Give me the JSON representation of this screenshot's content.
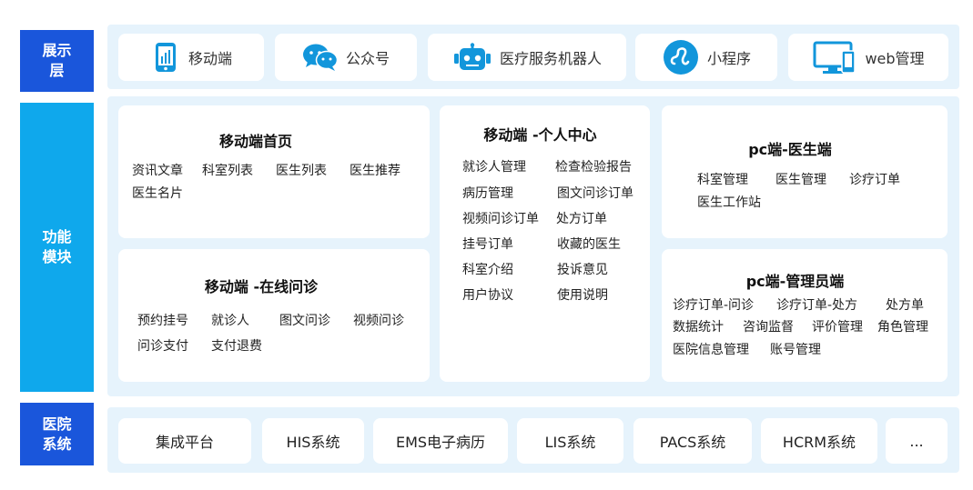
{
  "colors": {
    "presentation_label": "#1a56db",
    "function_label": "#0fa8ec",
    "hospital_label": "#1a56db",
    "band": "#e6f3fc",
    "icon": "#1296db"
  },
  "layers": {
    "presentation": {
      "label": "展示层",
      "items": [
        {
          "label": "移动端",
          "icon": "mobile-phone-icon"
        },
        {
          "label": "公众号",
          "icon": "wechat-icon"
        },
        {
          "label": "医疗服务机器人",
          "icon": "robot-icon"
        },
        {
          "label": "小程序",
          "icon": "mini-program-icon"
        },
        {
          "label": "web管理",
          "icon": "desktop-monitor-icon"
        }
      ]
    },
    "function": {
      "label": "功能模块",
      "modules": {
        "mobile_home": {
          "title": "移动端首页",
          "rows": [
            [
              "资讯文章",
              "科室列表",
              "医生列表",
              "医生推荐"
            ],
            [
              "医生名片"
            ]
          ]
        },
        "mobile_consult": {
          "title": "移动端 -在线问诊",
          "rows": [
            [
              "预约挂号",
              "就诊人",
              "图文问诊",
              "视频问诊"
            ],
            [
              "问诊支付",
              "支付退费"
            ]
          ]
        },
        "mobile_personal": {
          "title": "移动端 -个人中心",
          "rows": [
            [
              "就诊人管理",
              "检查检验报告"
            ],
            [
              "病历管理",
              "图文问诊订单"
            ],
            [
              "视频问诊订单",
              "处方订单"
            ],
            [
              "挂号订单",
              "收藏的医生"
            ],
            [
              "科室介绍",
              "投诉意见"
            ],
            [
              "用户协议",
              "使用说明"
            ]
          ]
        },
        "pc_doctor": {
          "title": "pc端-医生端",
          "rows": [
            [
              "科室管理",
              "医生管理",
              "诊疗订单"
            ],
            [
              "医生工作站"
            ]
          ]
        },
        "pc_admin": {
          "title": "pc端-管理员端",
          "rows": [
            [
              "诊疗订单-问诊",
              "诊疗订单-处方",
              "处方单"
            ],
            [
              "数据统计",
              "咨询监督",
              "评价管理",
              "角色管理"
            ],
            [
              "医院信息管理",
              "账号管理"
            ]
          ]
        }
      }
    },
    "hospital": {
      "label": "医院系统",
      "items": [
        "集成平台",
        "HIS系统",
        "EMS电子病历",
        "LIS系统",
        "PACS系统",
        "HCRM系统",
        "..."
      ]
    }
  }
}
